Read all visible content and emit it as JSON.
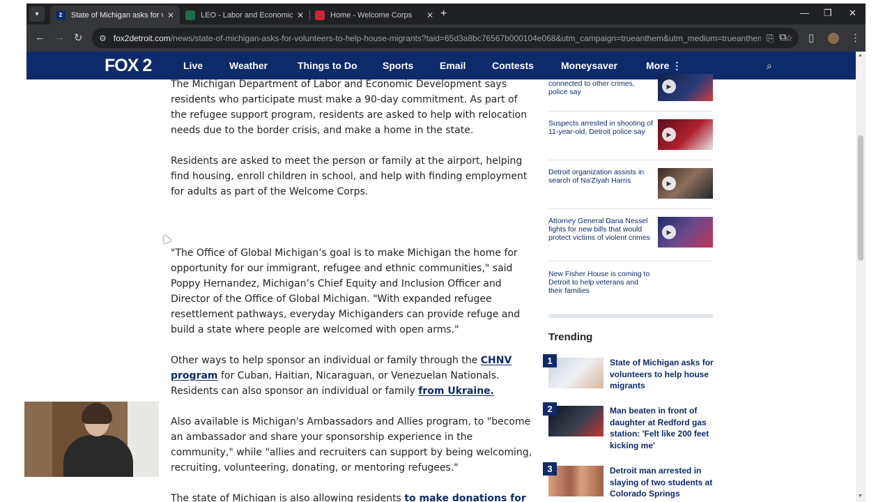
{
  "browser": {
    "tabs": [
      {
        "title": "State of Michigan asks for volunteers",
        "active": true,
        "favicon_color": "#0d2a6b",
        "favicon_text": "2"
      },
      {
        "title": "LEO - Labor and Economic Opportunity",
        "active": false,
        "favicon_color": "#1f6b4a",
        "favicon_text": ""
      },
      {
        "title": "Home - Welcome Corps",
        "active": false,
        "favicon_color": "#d0243a",
        "favicon_text": ""
      }
    ],
    "url_domain": "fox2detroit.com",
    "url_path": "/news/state-of-michigan-asks-for-volunteers-to-help-house-migrants?taid=65d3a8bc76567b000104e068&utm_campaign=trueanthem&utm_medium=trueanthem&..."
  },
  "site": {
    "logo": "FOX 2",
    "nav": [
      "Live",
      "Weather",
      "Things to Do",
      "Sports",
      "Email",
      "Contests",
      "Moneysaver",
      "More ⋮"
    ],
    "brand_color": "#0d2a6b"
  },
  "article": {
    "p1": "The Michigan Department of Labor and Economic Development says residents who participate must make a 90-day commitment. As part of the refugee support program, residents are asked to help with relocation needs due to the border crisis, and make a home in the state.",
    "p2": "Residents are asked to meet the person or family at the airport, helping find housing, enroll children in school, and help with finding employment for adults as part of the Welcome Corps.",
    "p3": "\"The Office of Global Michigan’s goal is to make Michigan the home for opportunity for our immigrant, refugee and ethnic communities,\" said Poppy Hernandez, Michigan’s Chief Equity and Inclusion Officer and Director of the Office of Global Michigan. \"With expanded refugee resettlement pathways, everyday Michiganders can provide refuge and build a state where people are welcomed with open arms.\"",
    "p4_before": "Other ways to help sponsor an individual or family through the ",
    "p4_link1": "CHNV program",
    "p4_middle": " for Cuban, Haitian, Nicaraguan, or Venezuelan Nationals. Residents can also sponsor an individual or family ",
    "p4_link2": "from Ukraine.",
    "p5": "Also available is Michigan's Ambassadors and Allies program, to \"become an ambassador and share your sponsorship experience in the community,\" while \"allies and recruiters can support by being welcoming, recruiting, volunteering, donating, or mentoring refugees.\"",
    "p6_before": "The state of Michigan is also allowing residents ",
    "p6_link": "to make donations for"
  },
  "related": [
    {
      "title": "connected to other crimes, police say"
    },
    {
      "title": "Suspects arrested in shooting of 11-year-old, Detroit police say"
    },
    {
      "title": "Detroit organization assists in search of Na'Ziyah Harris"
    },
    {
      "title": "Attorney General Dana Nessel fights for new bills that would protect victims of violent crimes"
    },
    {
      "title": "New Fisher House is coming to Detroit to help veterans and their families"
    }
  ],
  "trending": {
    "heading": "Trending",
    "items": [
      {
        "rank": "1",
        "title": "State of Michigan asks for volunteers to help house migrants"
      },
      {
        "rank": "2",
        "title": "Man beaten in front of daughter at Redford gas station: 'Felt like 200 feet kicking me'"
      },
      {
        "rank": "3",
        "title": "Detroit man arrested in slaying of two students at Colorado Springs"
      }
    ]
  }
}
